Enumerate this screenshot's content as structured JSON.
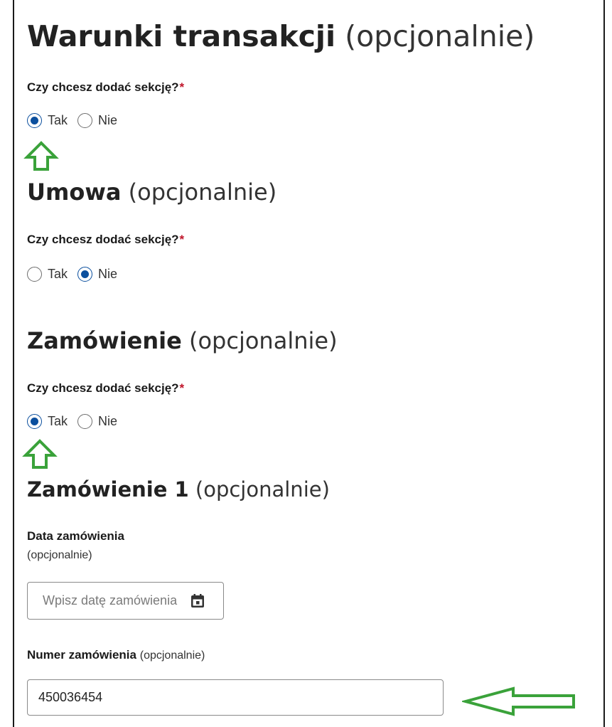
{
  "sections": {
    "warunki": {
      "title_strong": "Warunki transakcji",
      "title_optional": "(opcjonalnie)",
      "question": "Czy chcesz dodać sekcję?",
      "required_mark": "*",
      "options": [
        "Tak",
        "Nie"
      ],
      "selected": "Tak"
    },
    "umowa": {
      "title_strong": "Umowa",
      "title_optional": "(opcjonalnie)",
      "question": "Czy chcesz dodać sekcję?",
      "required_mark": "*",
      "options": [
        "Tak",
        "Nie"
      ],
      "selected": "Nie"
    },
    "zamowienie": {
      "title_strong": "Zamówienie",
      "title_optional": "(opcjonalnie)",
      "question": "Czy chcesz dodać sekcję?",
      "required_mark": "*",
      "options": [
        "Tak",
        "Nie"
      ],
      "selected": "Tak"
    },
    "zamowienie1": {
      "title_strong": "Zamówienie 1",
      "title_optional": "(opcjonalnie)",
      "date_field": {
        "label": "Data zamówienia",
        "sublabel": "(opcjonalnie)",
        "placeholder": "Wpisz datę zamówienia",
        "icon": "calendar-icon"
      },
      "number_field": {
        "label": "Numer zamówienia",
        "label_optional": "(opcjonalnie)",
        "value": "450036454"
      }
    }
  },
  "annotations": {
    "arrow_color": "#3aa23a",
    "arrows": [
      "up-arrow-icon",
      "up-arrow-icon",
      "left-arrow-icon"
    ]
  },
  "colors": {
    "radio_checked": "#0b4f9e",
    "required": "#c0152a"
  }
}
